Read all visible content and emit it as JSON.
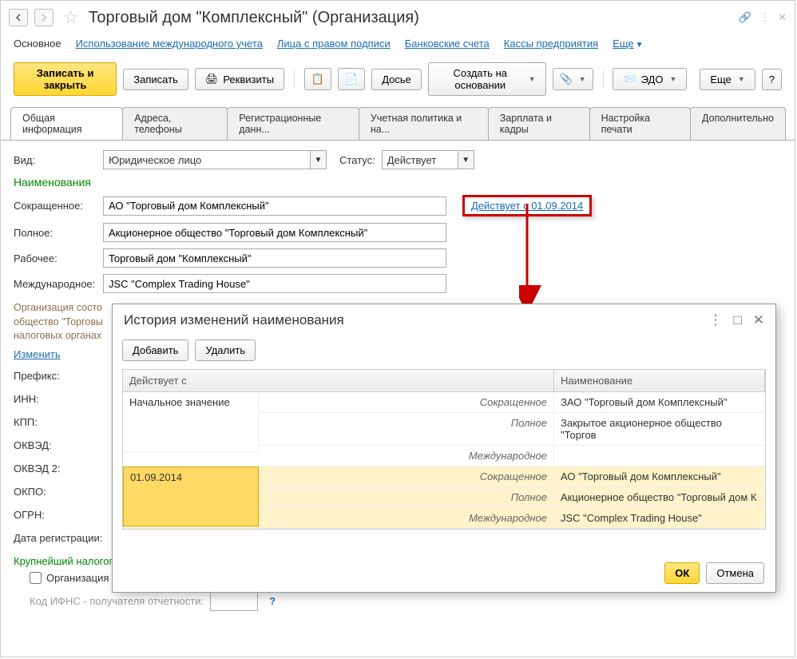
{
  "header": {
    "title": "Торговый дом \"Комплексный\" (Организация)"
  },
  "topnav": {
    "main": "Основное",
    "intl": "Использование международного учета",
    "signers": "Лица с правом подписи",
    "bank": "Банковские счета",
    "kassa": "Кассы предприятия",
    "more": "Еще"
  },
  "toolbar": {
    "save_close": "Записать и закрыть",
    "save": "Записать",
    "requisites": "Реквизиты",
    "dossier": "Досье",
    "create_based": "Создать на основании",
    "edo": "ЭДО",
    "more": "Еще",
    "help": "?"
  },
  "tabs": {
    "t1": "Общая информация",
    "t2": "Адреса, телефоны",
    "t3": "Регистрационные данн...",
    "t4": "Учетная политика и на...",
    "t5": "Зарплата и кадры",
    "t6": "Настройка печати",
    "t7": "Дополнительно"
  },
  "form": {
    "vid_label": "Вид:",
    "vid_value": "Юридическое лицо",
    "status_label": "Статус:",
    "status_value": "Действует",
    "naim_section": "Наименования",
    "short_label": "Сокращенное:",
    "short_value": "АО \"Торговый дом Комплексный\"",
    "effective_link": "Действует с 01.09.2014",
    "full_label": "Полное:",
    "full_value": "Акционерное общество \"Торговый дом Комплексный\"",
    "work_label": "Рабочее:",
    "work_value": "Торговый дом \"Комплексный\"",
    "intl_label": "Международное:",
    "intl_value": "JSC \"Complex Trading House\"",
    "hint": "Организация состо",
    "hint2": "общество \"Торговы",
    "hint3": "налоговых органах",
    "change_link": "Изменить",
    "prefix_label": "Префикс:",
    "inn_label": "ИНН:",
    "kpp_label": "КПП:",
    "okved_label": "ОКВЭД:",
    "okved2_label": "ОКВЭД 2:",
    "okpo_label": "ОКПО:",
    "ogrn_label": "ОГРН:",
    "regdate_label": "Дата регистрации:",
    "major_taxpayer": "Крупнейший налогоплательщик:",
    "is_major_cb": "Организация является крупнейшим налогоплательщиком",
    "ifns_label": "Код ИФНС - получателя отчетности:"
  },
  "popup": {
    "title": "История изменений наименования",
    "add": "Добавить",
    "delete": "Удалить",
    "col_date": "Действует с",
    "col_name": "Наименование",
    "ok": "ОК",
    "cancel": "Отмена",
    "rows": [
      {
        "date": "Начальное значение",
        "sub": [
          {
            "type": "Сокращенное",
            "val": "ЗАО \"Торговый дом Комплексный\""
          },
          {
            "type": "Полное",
            "val": "Закрытое акционерное общество \"Торгов"
          },
          {
            "type": "Международное",
            "val": ""
          }
        ]
      },
      {
        "date": "01.09.2014",
        "sub": [
          {
            "type": "Сокращенное",
            "val": "АО \"Торговый дом Комплексный\""
          },
          {
            "type": "Полное",
            "val": "Акционерное общество \"Торговый дом К"
          },
          {
            "type": "Международное",
            "val": "JSC \"Complex Trading House\""
          }
        ]
      }
    ]
  }
}
